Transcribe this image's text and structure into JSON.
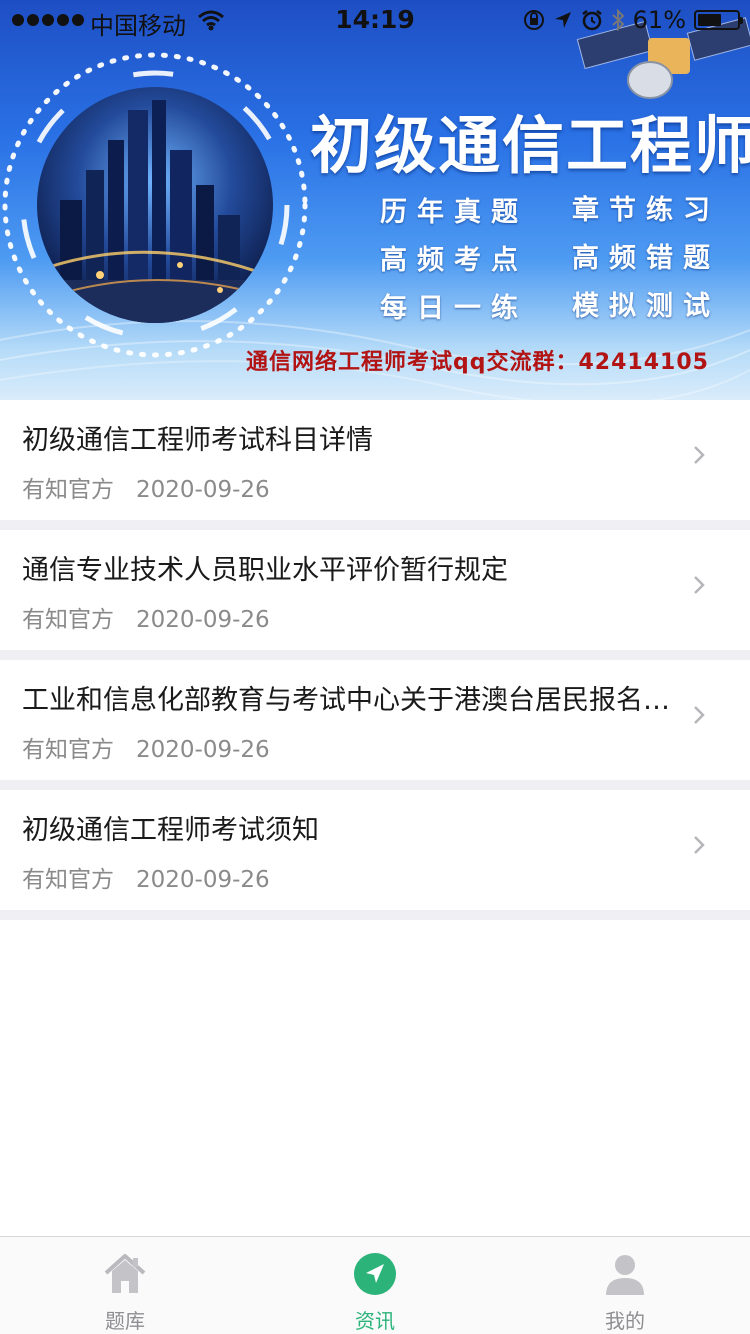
{
  "status_bar": {
    "carrier": "中国移动",
    "time": "14:19",
    "battery_percent": "61%",
    "battery_level": 0.61,
    "icons": [
      "signal-dots",
      "wifi-icon",
      "orientation-lock-icon",
      "location-arrow-icon",
      "alarm-icon",
      "bluetooth-icon",
      "battery-icon"
    ]
  },
  "banner": {
    "title": "初级通信工程师",
    "features": [
      "历年真题",
      "章节练习",
      "高频考点",
      "高频错题",
      "每日一练",
      "模拟测试"
    ],
    "qq_line": "通信网络工程师考试qq交流群：42414105"
  },
  "news": [
    {
      "title": "初级通信工程师考试科目详情",
      "source": "有知官方",
      "date": "2020-09-26"
    },
    {
      "title": "通信专业技术人员职业水平评价暂行规定",
      "source": "有知官方",
      "date": "2020-09-26"
    },
    {
      "title": "工业和信息化部教育与考试中心关于港澳台居民报名参加考试的通知",
      "source": "有知官方",
      "date": "2020-09-26"
    },
    {
      "title": "初级通信工程师考试须知",
      "source": "有知官方",
      "date": "2020-09-26"
    }
  ],
  "tabs": [
    {
      "label": "题库",
      "icon": "home-icon",
      "active": false
    },
    {
      "label": "资讯",
      "icon": "compass-icon",
      "active": true
    },
    {
      "label": "我的",
      "icon": "user-icon",
      "active": false
    }
  ],
  "colors": {
    "accent": "#2bb37a",
    "inactive": "#8e8e93",
    "separator": "#efeff4",
    "banner_red_text": "#b21414"
  }
}
